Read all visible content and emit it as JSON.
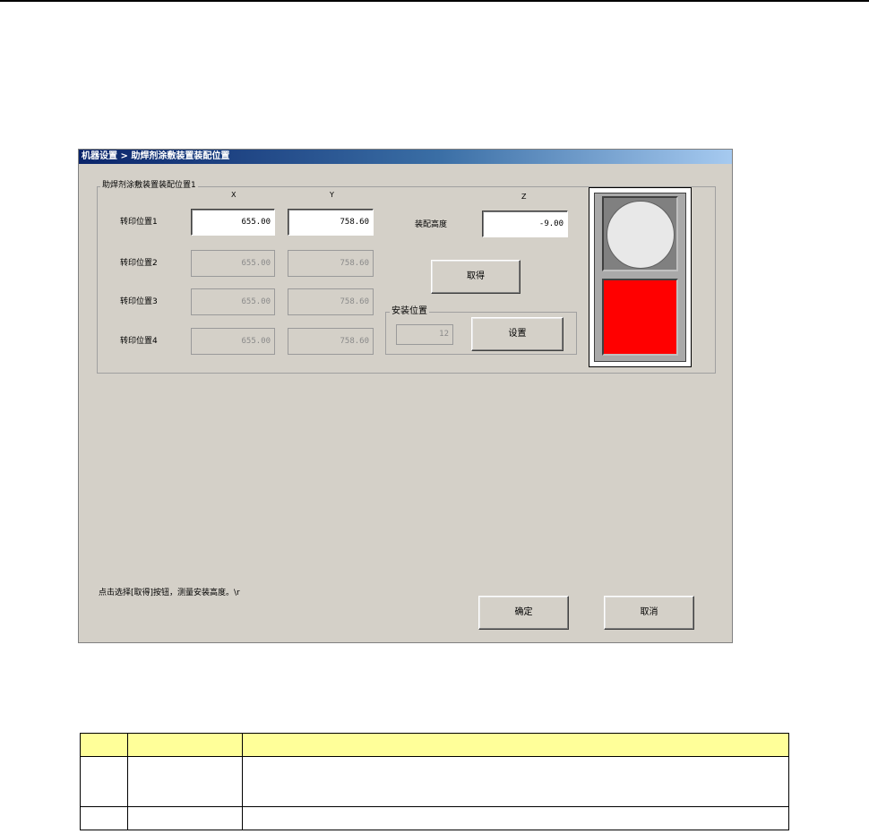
{
  "window": {
    "title": "机器设置 > 助焊剂涂敷装置装配位置",
    "group_title": "助焊剂涂敷装置装配位置1",
    "columns": {
      "x": "X",
      "y": "Y",
      "z": "Z"
    },
    "rows": [
      {
        "label": "转印位置1",
        "x": "655.00",
        "y": "758.60",
        "enabled": true
      },
      {
        "label": "转印位置2",
        "x": "655.00",
        "y": "758.60",
        "enabled": false
      },
      {
        "label": "转印位置3",
        "x": "655.00",
        "y": "758.60",
        "enabled": false
      },
      {
        "label": "转印位置4",
        "x": "655.00",
        "y": "758.60",
        "enabled": false
      }
    ],
    "height_label": "装配高度",
    "height_value": "-9.00",
    "acquire_button": "取得",
    "install_group": "安装位置",
    "install_value": "12",
    "set_button": "设置",
    "status_text": "点击选择[取得]按钮，测量安装高度。\\r",
    "ok_button": "确定",
    "cancel_button": "取消",
    "indicator": {
      "top_color": "#e8e8e8",
      "bottom_color": "#ff0000"
    }
  },
  "table": {
    "header_color": "#ffff99"
  }
}
